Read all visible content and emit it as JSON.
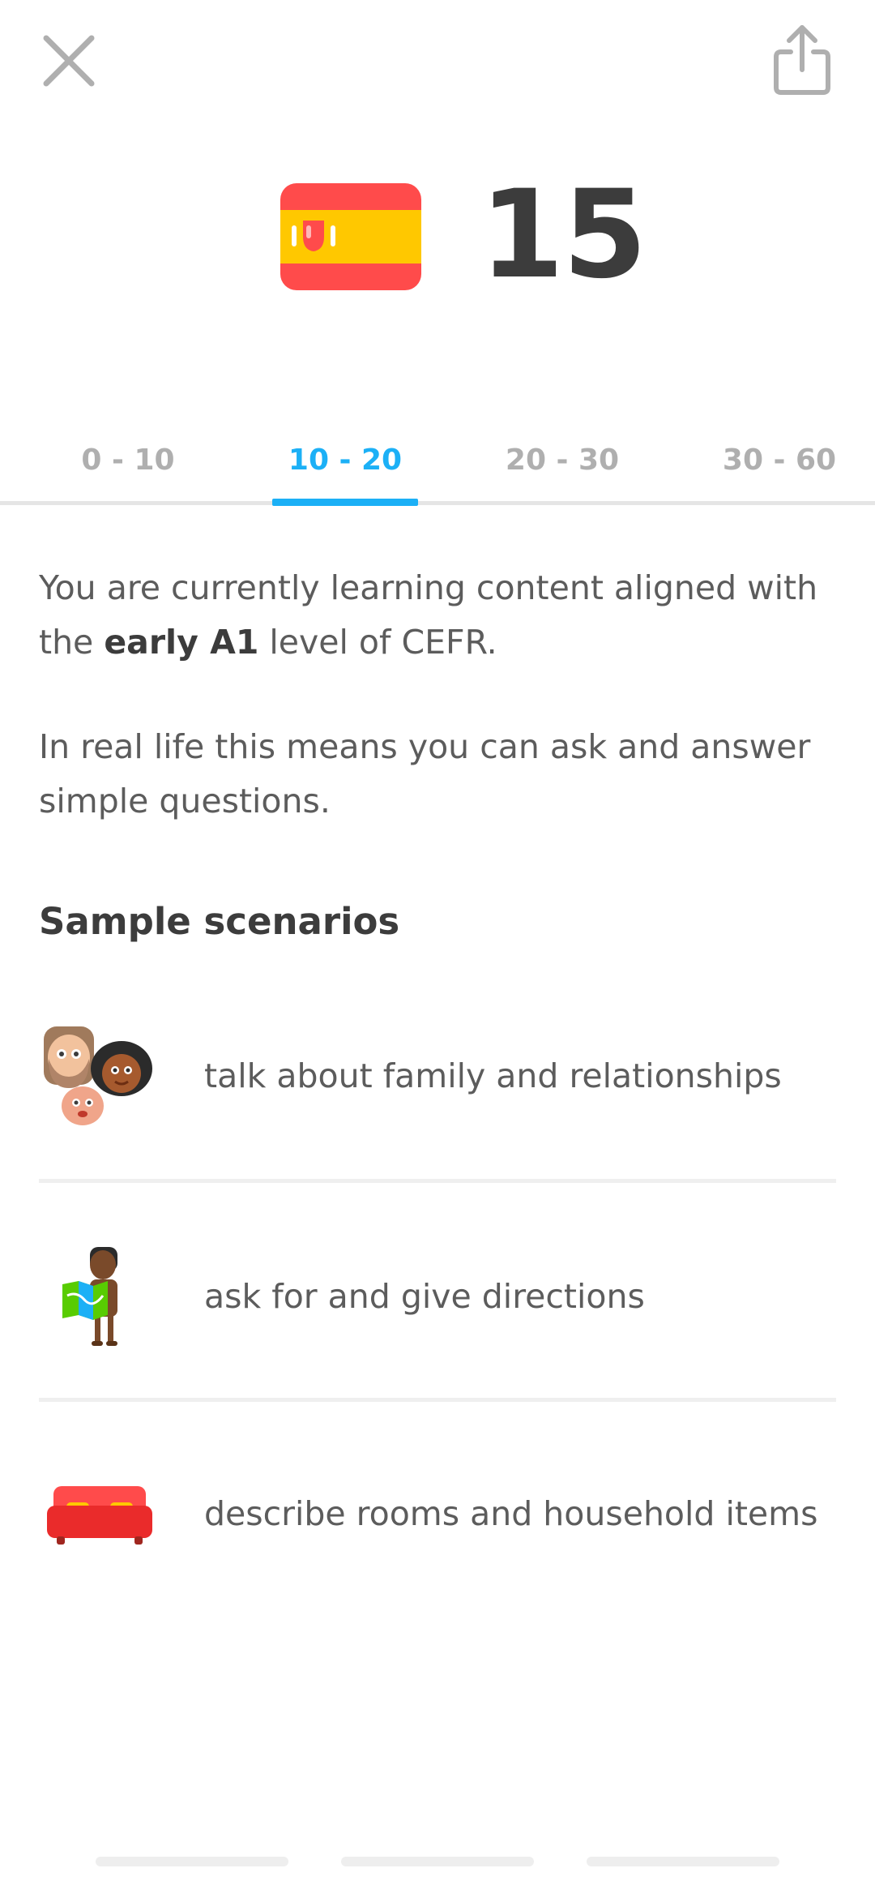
{
  "header": {
    "close_icon": "close-icon",
    "share_icon": "share-icon"
  },
  "course": {
    "flag_icon": "spain-flag-icon",
    "score": "15",
    "colors": {
      "flag_red": "#ff4b4b",
      "flag_yellow": "#ffc800"
    }
  },
  "tabs": [
    {
      "label": "0 - 10",
      "active": false
    },
    {
      "label": "10 - 20",
      "active": true
    },
    {
      "label": "20 - 30",
      "active": false
    },
    {
      "label": "30 - 60",
      "active": false
    }
  ],
  "description": {
    "line1_prefix": "You are currently learning content aligned with the",
    "level": "early A1",
    "line1_suffix": "level of CEFR.",
    "line2": "In real life this means you can ask and answer simple questions."
  },
  "section_title": "Sample scenarios",
  "scenarios": [
    {
      "icon": "family-icon",
      "label": "talk about family and relationships"
    },
    {
      "icon": "map-directions-icon",
      "label": "ask for and give directions"
    },
    {
      "icon": "sofa-icon",
      "label": "describe rooms and household items"
    }
  ],
  "colors": {
    "accent": "#1cb0f6",
    "tab_inactive": "#afafaf",
    "text": "#4b4b4b"
  }
}
